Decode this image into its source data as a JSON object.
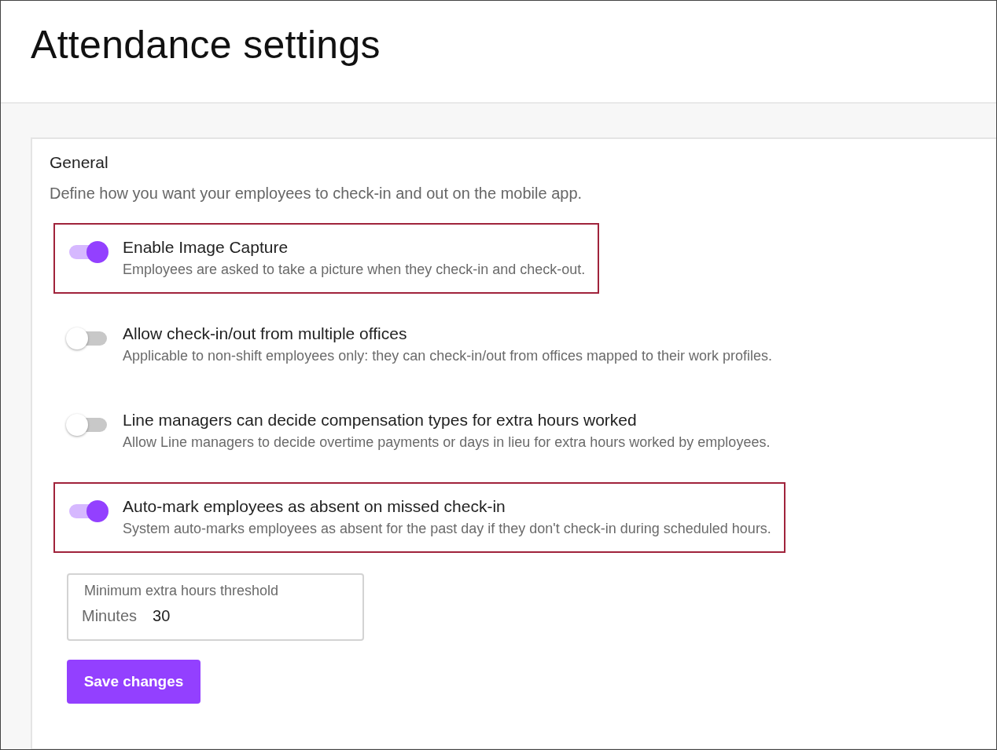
{
  "page": {
    "title": "Attendance settings"
  },
  "section": {
    "title": "General",
    "description": "Define how you want your employees to check-in and out on the mobile app."
  },
  "settings": [
    {
      "title": "Enable Image Capture",
      "description": "Employees are asked to take a picture when they check-in and check-out.",
      "on": true,
      "highlighted": true
    },
    {
      "title": "Allow check-in/out from multiple offices",
      "description": "Applicable to non-shift employees only: they can check-in/out from offices mapped to their work profiles.",
      "on": false,
      "highlighted": false
    },
    {
      "title": "Line managers can decide compensation types for extra hours worked",
      "description": "Allow Line managers to decide overtime payments or days in lieu for extra hours worked by employees.",
      "on": false,
      "highlighted": false
    },
    {
      "title": "Auto-mark employees as absent on missed check-in",
      "description": "System auto-marks employees as absent for the past day if they don't check-in during scheduled hours.",
      "on": true,
      "highlighted": true
    }
  ],
  "threshold_field": {
    "label": "Minimum extra hours threshold",
    "unit": "Minutes",
    "value": "30"
  },
  "buttons": {
    "save": "Save changes"
  }
}
